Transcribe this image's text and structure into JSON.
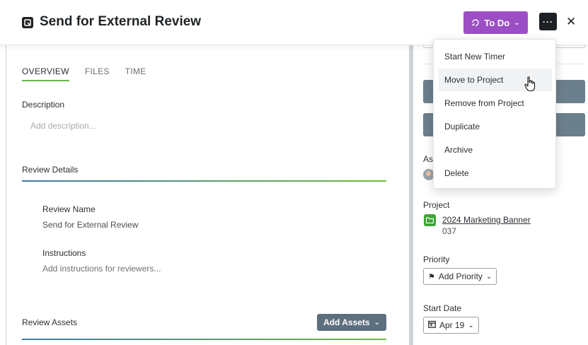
{
  "header": {
    "title": "Send for External Review",
    "status_label": "To Do",
    "more_label": "···",
    "close_label": "✕"
  },
  "tabs": [
    {
      "label": "OVERVIEW",
      "active": true
    },
    {
      "label": "FILES",
      "active": false
    },
    {
      "label": "TIME",
      "active": false
    }
  ],
  "overview": {
    "description_label": "Description",
    "description_placeholder": "Add description...",
    "review_details_heading": "Review Details",
    "review_name_label": "Review Name",
    "review_name_value": "Send for External Review",
    "instructions_label": "Instructions",
    "instructions_placeholder": "Add instructions for reviewers...",
    "review_assets_heading": "Review Assets",
    "add_assets_label": "Add Assets"
  },
  "sidebar": {
    "assignees_fragment": "As",
    "project_label": "Project",
    "project_name": "2024 Marketing Banner",
    "project_number": "037",
    "priority_label": "Priority",
    "priority_value": "Add Priority",
    "start_date_label": "Start Date",
    "start_date_value": "Apr 19"
  },
  "menu": {
    "items": [
      {
        "label": "Start New Timer"
      },
      {
        "label": "Move to Project",
        "hovered": true
      },
      {
        "label": "Remove from Project"
      },
      {
        "label": "Duplicate"
      },
      {
        "label": "Archive"
      },
      {
        "label": "Delete"
      }
    ]
  },
  "colors": {
    "status_purple": "#9c4fc4",
    "accent_green": "#69b84a",
    "button_slate": "#5e6f7e"
  }
}
